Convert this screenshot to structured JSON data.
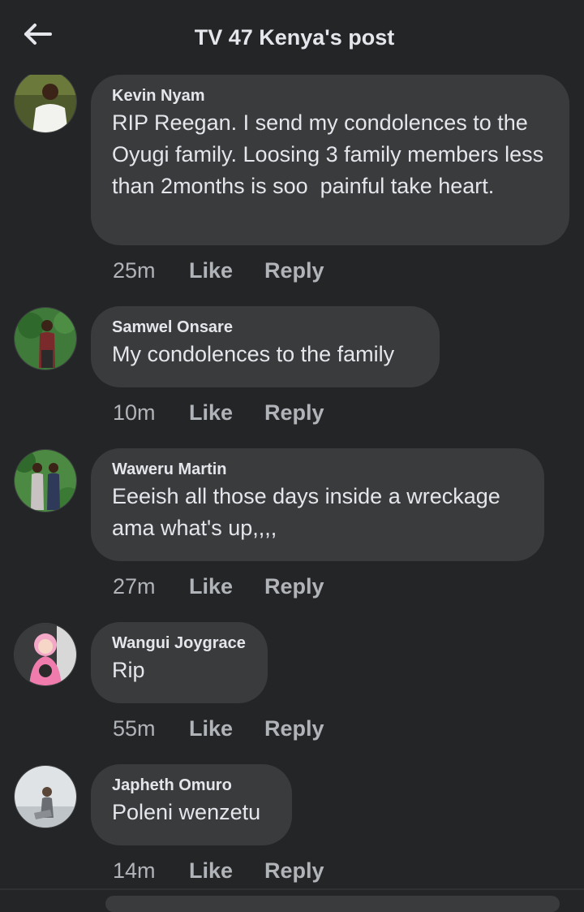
{
  "header": {
    "title": "TV 47 Kenya's post",
    "back_icon": "arrow-left-icon"
  },
  "comments": [
    {
      "author": "Kevin Nyam",
      "text": "RIP Reegan. I send my condolences to the Oyugi family. Loosing 3 family members less than 2months is soo  painful take heart.",
      "time": "25m",
      "like": "Like",
      "reply": "Reply"
    },
    {
      "author": "Samwel Onsare",
      "text": "My condolences to the family",
      "time": "10m",
      "like": "Like",
      "reply": "Reply"
    },
    {
      "author": "Waweru Martin",
      "text": "Eeeish all those days inside a wreckage ama what's up,,,,",
      "time": "27m",
      "like": "Like",
      "reply": "Reply"
    },
    {
      "author": "Wangui Joygrace",
      "text": "Rip",
      "time": "55m",
      "like": "Like",
      "reply": "Reply"
    },
    {
      "author": "Japheth Omuro",
      "text": "Poleni wenzetu",
      "time": "14m",
      "like": "Like",
      "reply": "Reply"
    }
  ],
  "colors": {
    "background": "#242526",
    "bubble": "#3a3b3c",
    "primary_text": "#e4e6eb",
    "secondary_text": "#b0b3b8"
  }
}
